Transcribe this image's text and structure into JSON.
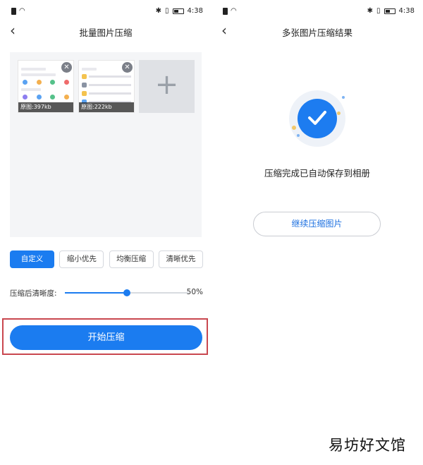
{
  "status_bar": {
    "time": "4:38"
  },
  "left_screen": {
    "title": "批量图片压缩",
    "images": [
      {
        "label": "原图:397kb"
      },
      {
        "label": "原图:222kb"
      }
    ],
    "add_icon": "+",
    "options": [
      "自定义",
      "缩小优先",
      "均衡压缩",
      "清晰优先"
    ],
    "selected_option": "自定义",
    "slider": {
      "label": "压缩后清晰度:",
      "value": 50,
      "value_label": "50%"
    },
    "start_button": "开始压缩"
  },
  "right_screen": {
    "title": "多张图片压缩结果",
    "success_icon": "check-circle-icon",
    "message": "压缩完成已自动保存到相册",
    "continue_button": "继续压缩图片"
  },
  "watermark": "易坊好文馆",
  "colors": {
    "accent": "#1b7cf0",
    "highlight_border": "#c9474f",
    "image_area_bg": "#f4f5f7"
  }
}
